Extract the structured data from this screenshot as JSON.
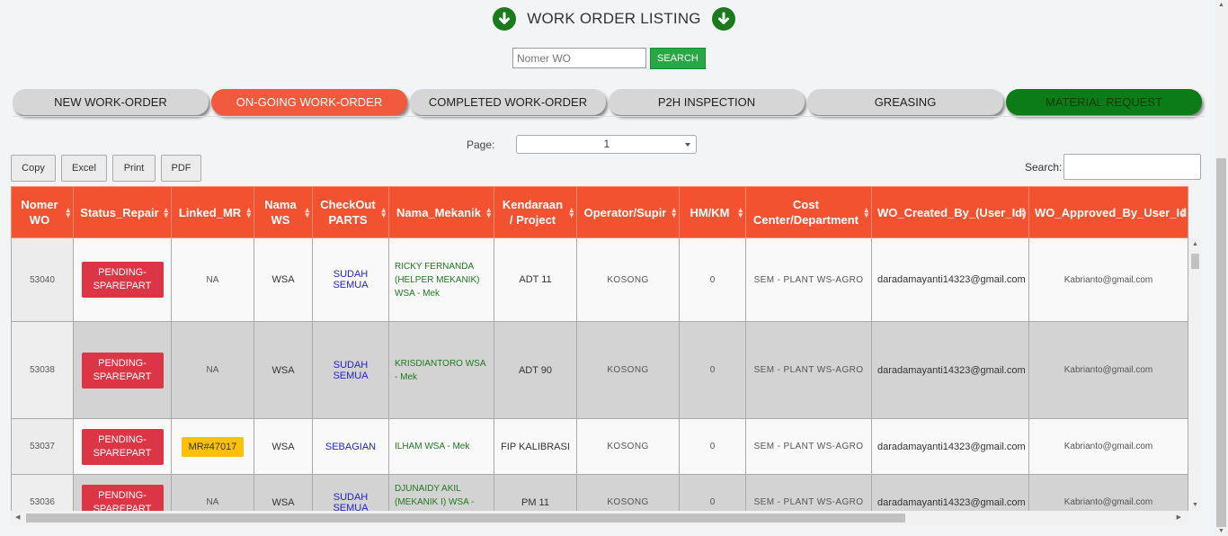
{
  "header": {
    "title": "WORK ORDER LISTING"
  },
  "search": {
    "placeholder": "Nomer WO",
    "button_label": "SEARCH"
  },
  "tabs": [
    {
      "label": "NEW WORK-ORDER"
    },
    {
      "label": "ON-GOING WORK-ORDER"
    },
    {
      "label": "COMPLETED WORK-ORDER"
    },
    {
      "label": "P2H INSPECTION"
    },
    {
      "label": "GREASING"
    },
    {
      "label": "MATERIAL REQUEST"
    }
  ],
  "pager": {
    "label": "Page:",
    "selected": "1"
  },
  "export": {
    "copy": "Copy",
    "excel": "Excel",
    "print": "Print",
    "pdf": "PDF"
  },
  "table_search": {
    "label": "Search:"
  },
  "colors": {
    "header": "#f2522f",
    "active_tab": "#f25a3d",
    "green_tab": "#0c7d16",
    "pending": "#dc3545",
    "mr": "#ffc107"
  },
  "table": {
    "columns": [
      "Nomer WO",
      "Status_Repair",
      "Linked_MR",
      "Nama WS",
      "CheckOut PARTS",
      "Nama_Mekanik",
      "Kendaraan / Project",
      "Operator/Supir",
      "HM/KM",
      "Cost Center/Department",
      "WO_Created_By_(User_Id)",
      "WO_Approved_By_User_Id"
    ],
    "rows": [
      {
        "wo": "53040",
        "status": "PENDING-SPAREPART",
        "mr": "NA",
        "ws": "WSA",
        "parts": "SUDAH SEMUA",
        "mekanik": "RICKY FERNANDA (HELPER MEKANIK) WSA - Mek",
        "kendaraan": "ADT 11",
        "operator": "KOSONG",
        "hm": "0",
        "cost": "SEM - PLANT WS-AGRO",
        "created": "daradamayanti14323@gmail.com",
        "approved": "Kabrianto@gmail.com"
      },
      {
        "wo": "53038",
        "status": "PENDING-SPAREPART",
        "mr": "NA",
        "ws": "WSA",
        "parts": "SUDAH SEMUA",
        "mekanik": "KRISDIANTORO WSA - Mek",
        "kendaraan": "ADT 90",
        "operator": "KOSONG",
        "hm": "0",
        "cost": "SEM - PLANT WS-AGRO",
        "created": "daradamayanti14323@gmail.com",
        "approved": "Kabrianto@gmail.com"
      },
      {
        "wo": "53037",
        "status": "PENDING-SPAREPART",
        "mr": "MR#47017",
        "ws": "WSA",
        "parts": "SEBAGIAN",
        "mekanik": "ILHAM WSA - Mek",
        "kendaraan": "FIP KALIBRASI",
        "operator": "KOSONG",
        "hm": "0",
        "cost": "SEM - PLANT WS-AGRO",
        "created": "daradamayanti14323@gmail.com",
        "approved": "Kabrianto@gmail.com"
      },
      {
        "wo": "53036",
        "status": "PENDING-SPAREPART",
        "mr": "NA",
        "ws": "WSA",
        "parts": "SUDAH SEMUA",
        "mekanik": "DJUNAIDY AKIL (MEKANIK I) WSA - Mek",
        "kendaraan": "PM 11",
        "operator": "KOSONG",
        "hm": "0",
        "cost": "SEM - PLANT WS-AGRO",
        "created": "daradamayanti14323@gmail.com",
        "approved": "Kabrianto@gmail.com"
      }
    ]
  }
}
